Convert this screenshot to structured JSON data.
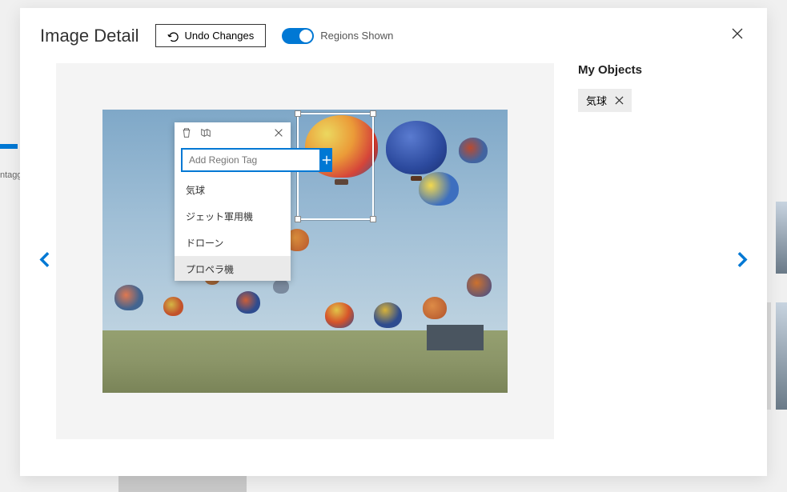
{
  "header": {
    "title": "Image Detail",
    "undo_label": "Undo Changes",
    "toggle_label": "Regions Shown"
  },
  "tag_popup": {
    "input_placeholder": "Add Region Tag",
    "options": [
      "気球",
      "ジェット軍用機",
      "ドローン",
      "プロペラ機"
    ]
  },
  "sidebar": {
    "title": "My Objects",
    "objects": [
      {
        "label": "気球"
      }
    ]
  },
  "background": {
    "side_label": "ntagg"
  }
}
